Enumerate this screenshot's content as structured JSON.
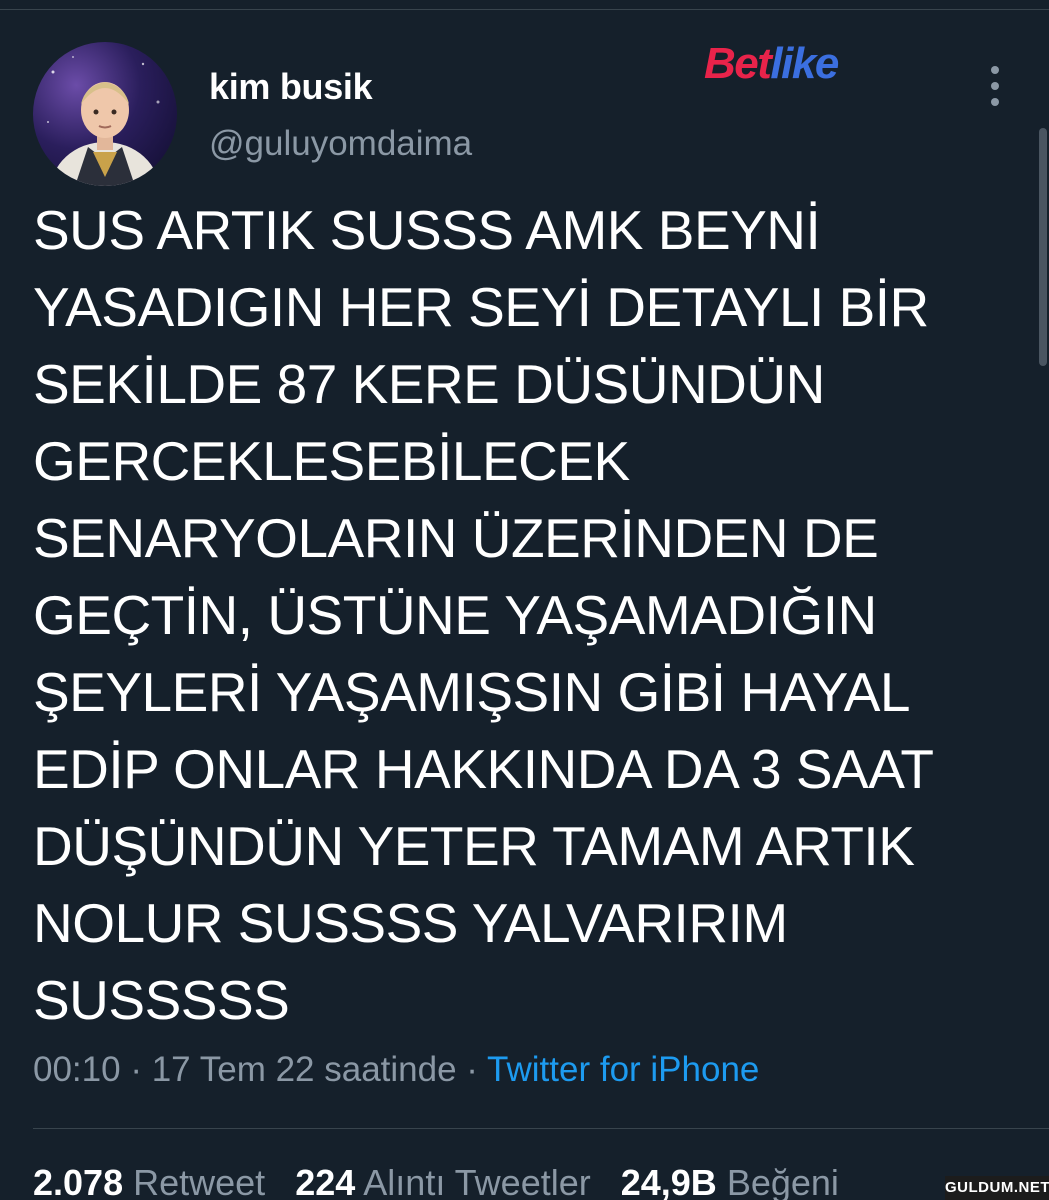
{
  "user": {
    "display_name": "kim busik",
    "handle": "@guluyomdaima"
  },
  "brand_logo": {
    "part1": "Bet",
    "part2": "like",
    "color1": "#e8234a",
    "color2": "#3b6fe0"
  },
  "tweet": {
    "lines": [
      "SUS ARTIK SUSSS AMK BEYNİ",
      "YASADIGIN HER SEYİ DETAYLI BİR",
      "SEKİLDE 87 KERE DÜSÜNDÜN",
      "GERCEKLESEBİLECEK",
      "SENARYOLARIN ÜZERİNDEN DE",
      "GEÇTİN, ÜSTÜNE YAŞAMADIĞIN",
      "ŞEYLERİ YAŞAMIŞSIN GİBİ HAYAL",
      "EDİP ONLAR HAKKINDA DA 3 SAAT",
      "DÜŞÜNDÜN YETER TAMAM ARTIK",
      "NOLUR SUSSSS YALVARIRIM",
      "SUSSSSS"
    ]
  },
  "meta": {
    "time": "00:10",
    "date": "17 Tem 22 saatinde",
    "separator": " · ",
    "source": "Twitter for iPhone"
  },
  "stats": {
    "retweets_count": "2.078",
    "retweets_label": "Retweet",
    "quotes_count": "224",
    "quotes_label": "Alıntı Tweetler",
    "likes_count": "24,9B",
    "likes_label": "Beğeni"
  },
  "watermark": "GULDUM.NET",
  "colors": {
    "background": "#15202b",
    "secondary_text": "#8b98a5",
    "link": "#1d9bf0",
    "divider": "#38444d"
  },
  "icons": {
    "more": "more-vertical-icon"
  }
}
